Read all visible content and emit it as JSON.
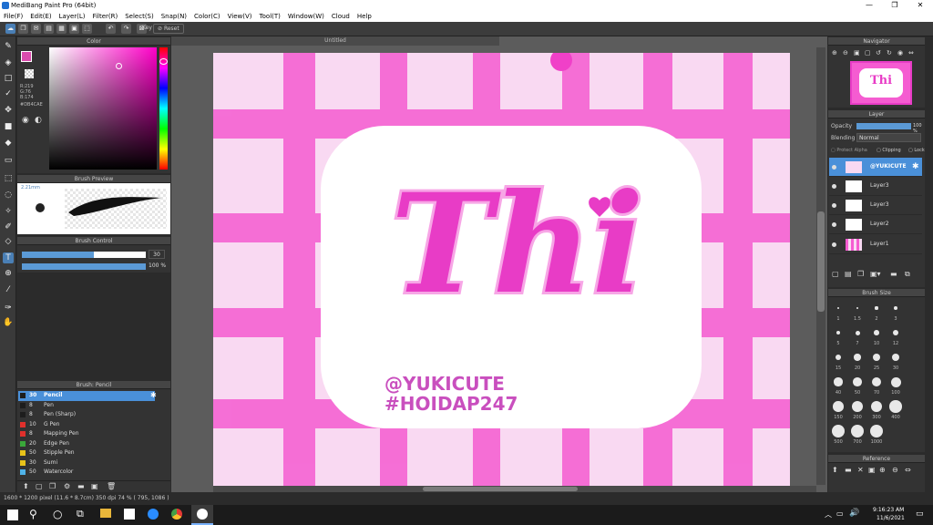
{
  "window": {
    "title": "MediBang Paint Pro (64bit)",
    "min": "—",
    "max": "❐",
    "close": "✕"
  },
  "menu": [
    "File(F)",
    "Edit(E)",
    "Layer(L)",
    "Filter(R)",
    "Select(S)",
    "Snap(N)",
    "Color(C)",
    "View(V)",
    "Tool(T)",
    "Window(W)",
    "Cloud",
    "Help"
  ],
  "toolbar": {
    "key_label": "Key",
    "reset_label": "Reset"
  },
  "color_panel": {
    "title": "Color",
    "r": "R:219",
    "g": "G:76",
    "b": "B:174",
    "hex": "#DB4CAE",
    "main_color": "#DB4CAE"
  },
  "brush_preview": {
    "title": "Brush Preview",
    "size": "2.21mm"
  },
  "brush_control": {
    "title": "Brush Control",
    "size_value": "30",
    "opacity_value": "100 %",
    "size_fraction": 0.58,
    "opacity_fraction": 1.0
  },
  "brush_list": {
    "title": "Brush: Pencil",
    "items": [
      {
        "size": "30",
        "name": "Pencil",
        "color": "#1d1d1d",
        "selected": true
      },
      {
        "size": "8",
        "name": "Pen",
        "color": "#1d1d1d"
      },
      {
        "size": "8",
        "name": "Pen (Sharp)",
        "color": "#1d1d1d"
      },
      {
        "size": "10",
        "name": "G Pen",
        "color": "#e0302c"
      },
      {
        "size": "8",
        "name": "Mapping Pen",
        "color": "#e0302c"
      },
      {
        "size": "20",
        "name": "Edge Pen",
        "color": "#3aa73a"
      },
      {
        "size": "50",
        "name": "Stipple Pen",
        "color": "#e8c31a"
      },
      {
        "size": "30",
        "name": "Sumi",
        "color": "#e8c31a"
      },
      {
        "size": "50",
        "name": "Watercolor",
        "color": "#4fb3e8"
      }
    ]
  },
  "document": {
    "tab": "Untitled",
    "main_text": "Thi",
    "tag1": "@YUKICUTE",
    "tag2": "#HOIDAP247"
  },
  "status": {
    "text": "1600 * 1200 pixel  (11.6 * 8.7cm)  350 dpi  74 %  ( 795, 1086 )"
  },
  "navigator": {
    "title": "Navigator",
    "thumb_text": "Thi"
  },
  "layer_panel": {
    "title": "Layer",
    "opacity_label": "Opacity",
    "opacity_value": "100 %",
    "blending_label": "Blending",
    "blending_value": "Normal",
    "protect_alpha": "Protect Alpha",
    "clipping": "Clipping",
    "lock": "Lock",
    "layers": [
      "@YUKICUTE",
      "Layer3",
      "Layer3",
      "Layer2",
      "Layer1"
    ]
  },
  "brush_size": {
    "title": "Brush Size",
    "sizes": [
      "1",
      "1.5",
      "2",
      "3",
      "5",
      "7",
      "10",
      "12",
      "15",
      "20",
      "25",
      "30",
      "40",
      "50",
      "70",
      "100",
      "150",
      "200",
      "300",
      "400",
      "500",
      "700",
      "1000"
    ]
  },
  "reference": {
    "title": "Reference"
  },
  "clock": {
    "time": "9:16:23 AM",
    "date": "11/6/2021"
  },
  "colors": {
    "pink_dark": "#f55cd1",
    "pink_light": "#f9d9f2",
    "accent": "#e83cc6",
    "text_pink": "#c94fbe",
    "selection": "#4a90d9"
  }
}
